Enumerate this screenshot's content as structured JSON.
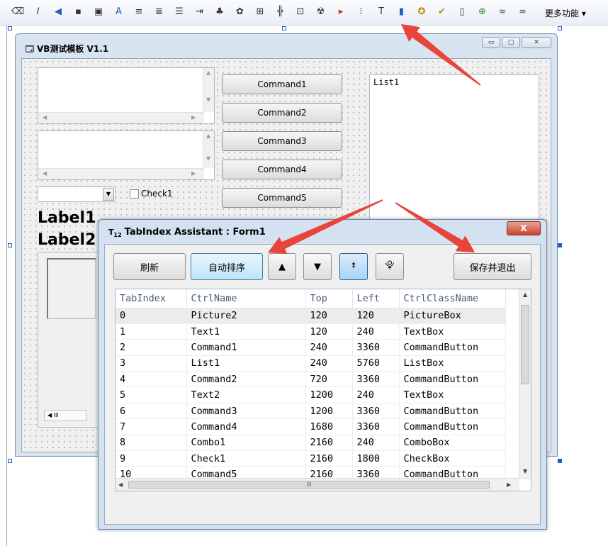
{
  "toolbar": {
    "icons": [
      "eraser-icon",
      "italic-icon",
      "vs-logo-icon",
      "save-icon",
      "save-all-icon",
      "ai-icon",
      "align-icon",
      "align-2-icon",
      "list-icon",
      "indent-icon",
      "tree-icon",
      "component-icon",
      "grid-icon",
      "crosshair-icon",
      "frame-icon",
      "debug-icon",
      "play-icon",
      "tabindex-list-icon",
      "tabindex-icon",
      "bookmark-icon",
      "folder-star-icon",
      "folder-check-icon",
      "document-icon",
      "add-document-icon",
      "binoculars-icon",
      "binoculars-2-icon"
    ],
    "more_label": "更多功能 ▾"
  },
  "vbform": {
    "title": "VB测试模板 V1.1",
    "commands": [
      "Command1",
      "Command2",
      "Command3",
      "Command4",
      "Command5"
    ],
    "list_label": "List1",
    "check_label": "Check1",
    "label1": "Label1",
    "label2": "Label2"
  },
  "dialog": {
    "title": "TabIndex Assistant : Form1",
    "close_label": "X",
    "buttons": {
      "refresh": "刷新",
      "auto_sort": "自动排序",
      "up": "▲",
      "down": "▼",
      "top": "⯒",
      "bottom": "⯓",
      "save_exit": "保存并退出"
    },
    "columns": [
      "TabIndex",
      "CtrlName",
      "Top",
      "Left",
      "CtrlClassName"
    ],
    "rows": [
      [
        "0",
        "Picture2",
        "120",
        "120",
        "PictureBox"
      ],
      [
        "1",
        "Text1",
        "120",
        "240",
        "TextBox"
      ],
      [
        "2",
        "Command1",
        "240",
        "3360",
        "CommandButton"
      ],
      [
        "3",
        "List1",
        "240",
        "5760",
        "ListBox"
      ],
      [
        "4",
        "Command2",
        "720",
        "3360",
        "CommandButton"
      ],
      [
        "5",
        "Text2",
        "1200",
        "240",
        "TextBox"
      ],
      [
        "6",
        "Command3",
        "1200",
        "3360",
        "CommandButton"
      ],
      [
        "7",
        "Command4",
        "1680",
        "3360",
        "CommandButton"
      ],
      [
        "8",
        "Combo1",
        "2160",
        "240",
        "ComboBox"
      ],
      [
        "9",
        "Check1",
        "2160",
        "1800",
        "CheckBox"
      ],
      [
        "10",
        "Command5",
        "2160",
        "3360",
        "CommandButton"
      ]
    ],
    "hscroll_grip": "III"
  },
  "colors": {
    "arrow": "#e8443a",
    "selection": "#1e5ec8"
  }
}
